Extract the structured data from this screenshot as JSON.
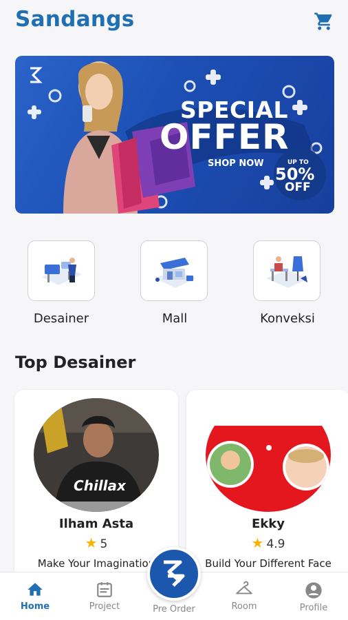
{
  "header": {
    "title": "Sandangs",
    "cart_icon": "cart-icon"
  },
  "banner": {
    "special": "SPECIAL",
    "offer": "OFFER",
    "shop_now": "SHOP NOW",
    "up_to": "UP TO",
    "percent": "50%",
    "off": "OFF"
  },
  "categories": [
    {
      "label": "Desainer",
      "icon": "designer-illustration-icon"
    },
    {
      "label": "Mall",
      "icon": "mall-illustration-icon"
    },
    {
      "label": "Konveksi",
      "icon": "tailor-illustration-icon"
    }
  ],
  "section_title": "Top Desainer",
  "designers": [
    {
      "name": "Ilham Asta",
      "rating": "5",
      "tagline": "Make Your Imagination"
    },
    {
      "name": "Ekky",
      "rating": "4.9",
      "tagline": "Build Your Different Face"
    }
  ],
  "nav": {
    "home": "Home",
    "project": "Project",
    "pre_order": "Pre Order",
    "room": "Room",
    "profile": "Profile"
  },
  "colors": {
    "brand": "#1f6fb2",
    "fab": "#1b57ad",
    "star": "#f4b400"
  }
}
